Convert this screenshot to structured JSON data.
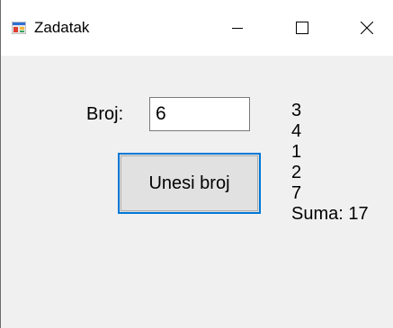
{
  "window": {
    "title": "Zadatak",
    "controls": [
      "minimize",
      "maximize",
      "close"
    ]
  },
  "icons": {
    "app": "app-icon",
    "minimize": "minimize-icon",
    "maximize": "maximize-icon",
    "close": "close-icon"
  },
  "form": {
    "broj_label": "Broj:",
    "broj_value": "6",
    "unesi_button": "Unesi broj"
  },
  "output": {
    "lines": [
      "3",
      "4",
      "1",
      "2",
      "7",
      "Suma: 17"
    ]
  },
  "colors": {
    "focus_border": "#0078d7",
    "button_bg": "#e1e1e1",
    "client_bg": "#f0f0f0"
  }
}
